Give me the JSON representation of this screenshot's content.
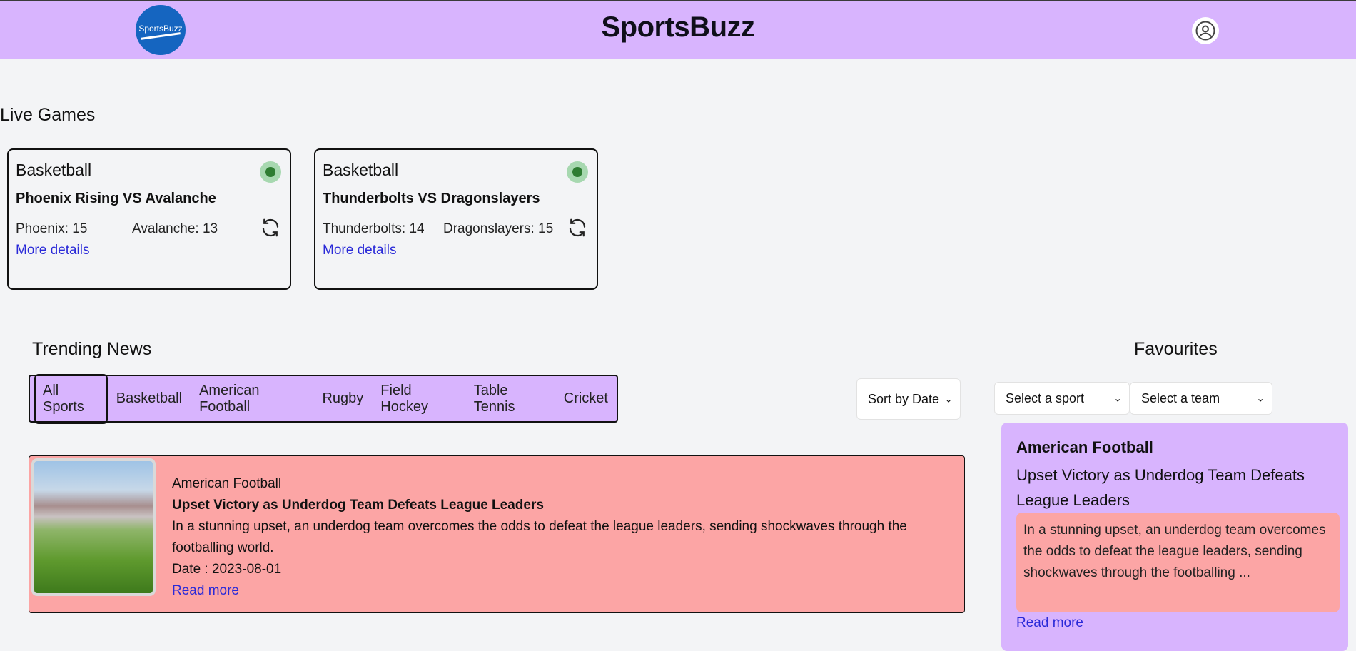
{
  "header": {
    "logo_text": "SportsBuzz",
    "title": "SportsBuzz",
    "profile_icon": "user-circle-icon"
  },
  "live": {
    "title": "Live Games",
    "games": [
      {
        "sport": "Basketball",
        "matchup": "Phoenix Rising VS Avalanche",
        "score_a": "Phoenix: 15",
        "score_b": "Avalanche: 13",
        "link": "More details"
      },
      {
        "sport": "Basketball",
        "matchup": "Thunderbolts VS Dragonslayers",
        "score_a": "Thunderbolts: 14",
        "score_b": "Dragonslayers: 15",
        "link": "More details"
      }
    ]
  },
  "trending": {
    "title": "Trending News",
    "tabs": [
      "All Sports",
      "Basketball",
      "American Football",
      "Rugby",
      "Field Hockey",
      "Table Tennis",
      "Cricket"
    ],
    "active_tab": "All Sports",
    "sort_label": "Sort by Date",
    "articles": [
      {
        "sport": "American Football",
        "headline": "Upset Victory as Underdog Team Defeats League Leaders",
        "summary": "In a stunning upset, an underdog team overcomes the odds to defeat the league leaders, sending shockwaves through the footballing world.",
        "date": "Date : 2023-08-01",
        "link": "Read more"
      }
    ]
  },
  "favourites": {
    "title": "Favourites",
    "sport_select": "Select a sport",
    "team_select": "Select a team",
    "card": {
      "sport": "American Football",
      "headline": "Upset Victory as Underdog Team Defeats League Leaders",
      "summary": "In a stunning upset, an underdog team overcomes the odds to defeat the league leaders, sending shockwaves through the footballing ...",
      "link": "Read more"
    }
  },
  "colors": {
    "header_bg": "#d8b4fe",
    "news_bg": "#fca5a5",
    "link": "#2a2ad8",
    "live_indicator": "#2e7d32"
  }
}
